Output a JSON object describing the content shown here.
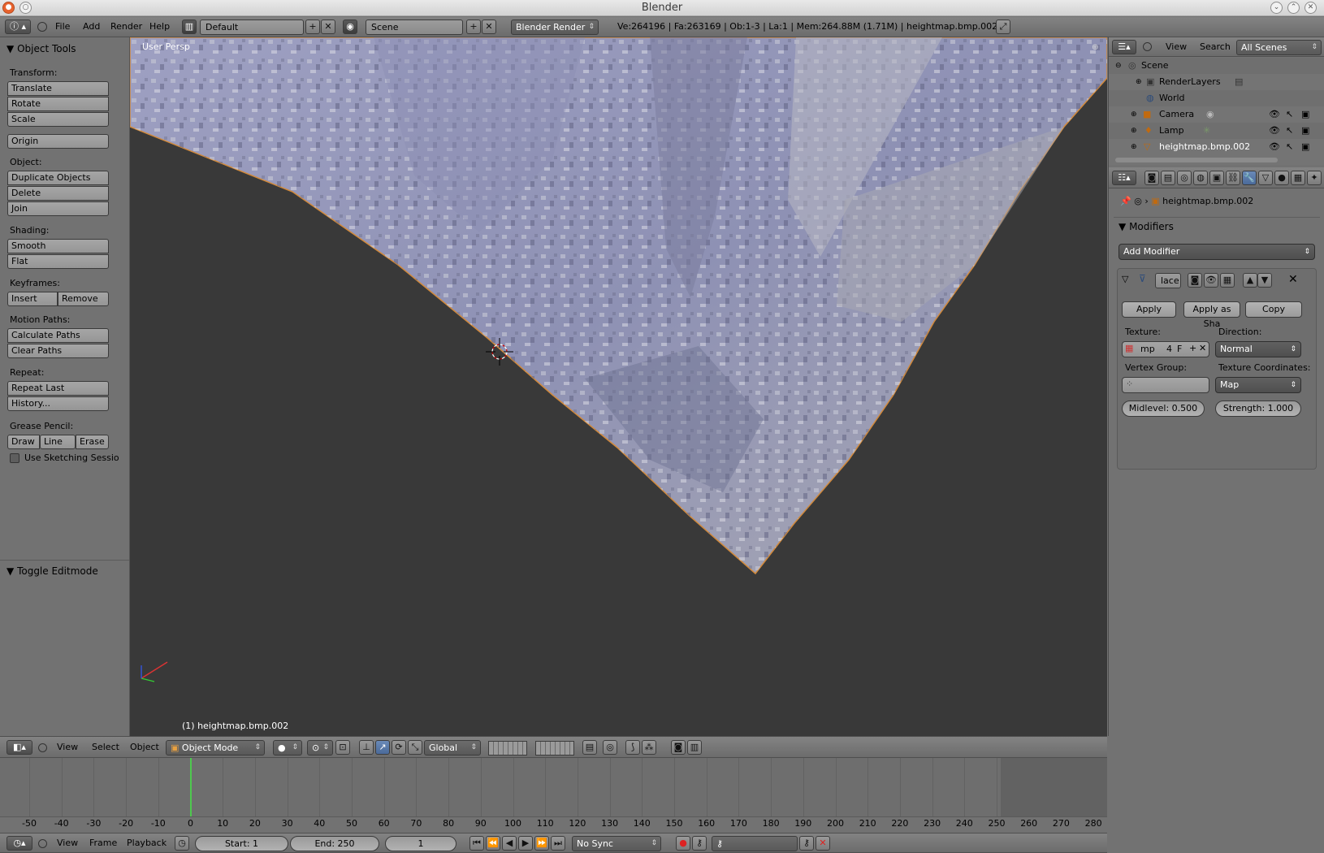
{
  "window": {
    "title": "Blender"
  },
  "info_header": {
    "menus": [
      "File",
      "Add",
      "Render",
      "Help"
    ],
    "layout": "Default",
    "scene": "Scene",
    "engine": "Blender Render",
    "stats": "Ve:264196 | Fa:263169 | Ob:1-3 | La:1 | Mem:264.88M (1.71M) | heightmap.bmp.002"
  },
  "tool_shelf": {
    "title": "Object Tools",
    "transform_label": "Transform:",
    "translate": "Translate",
    "rotate": "Rotate",
    "scale": "Scale",
    "origin": "Origin",
    "object_label": "Object:",
    "duplicate": "Duplicate Objects",
    "delete": "Delete",
    "join": "Join",
    "shading_label": "Shading:",
    "smooth": "Smooth",
    "flat": "Flat",
    "keyframes_label": "Keyframes:",
    "insert": "Insert",
    "remove": "Remove",
    "motion_label": "Motion Paths:",
    "calc_paths": "Calculate Paths",
    "clear_paths": "Clear Paths",
    "repeat_label": "Repeat:",
    "repeat_last": "Repeat Last",
    "history": "History...",
    "grease_label": "Grease Pencil:",
    "draw": "Draw",
    "line": "Line",
    "erase": "Erase",
    "sketching": "Use Sketching Sessio",
    "toggle_editmode": "Toggle Editmode"
  },
  "viewport": {
    "view_name": "User Persp",
    "object_label": "(1) heightmap.bmp.002"
  },
  "outliner": {
    "menus": [
      "View",
      "Search"
    ],
    "filter": "All Scenes",
    "items": [
      "Scene",
      "RenderLayers",
      "World",
      "Camera",
      "Lamp",
      "heightmap.bmp.002"
    ]
  },
  "properties": {
    "breadcrumb": "heightmap.bmp.002",
    "panel_title": "Modifiers",
    "add_modifier": "Add Modifier",
    "modifier_name": "lace",
    "apply": "Apply",
    "apply_shape": "Apply as Sha",
    "copy": "Copy",
    "texture_label": "Texture:",
    "texture_value": "mp",
    "texture_users": "4",
    "texture_fake": "F",
    "direction_label": "Direction:",
    "direction_value": "Normal",
    "vgroup_label": "Vertex Group:",
    "texcoords_label": "Texture Coordinates:",
    "texcoords_value": "Map",
    "midlevel": "Midlevel: 0.500",
    "strength": "Strength: 1.000"
  },
  "view3d_header": {
    "menus": [
      "View",
      "Select",
      "Object"
    ],
    "mode": "Object Mode",
    "orientation": "Global"
  },
  "timeline": {
    "ticks": [
      "-50",
      "-40",
      "-30",
      "-20",
      "-10",
      "0",
      "10",
      "20",
      "30",
      "40",
      "50",
      "60",
      "70",
      "80",
      "90",
      "100",
      "110",
      "120",
      "130",
      "140",
      "150",
      "160",
      "170",
      "180",
      "190",
      "200",
      "210",
      "220",
      "230",
      "240",
      "250",
      "260",
      "270",
      "280"
    ],
    "menus": [
      "View",
      "Frame",
      "Playback"
    ],
    "start": "Start: 1",
    "end": "End: 250",
    "current": "1",
    "sync": "No Sync"
  }
}
